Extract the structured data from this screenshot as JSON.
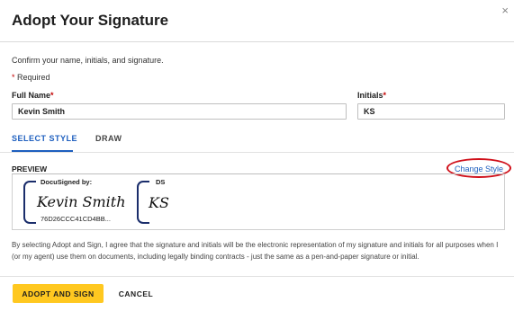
{
  "dialog": {
    "title": "Adopt Your Signature",
    "close_glyph": "×",
    "intro": "Confirm your name, initials, and signature.",
    "required_star": "*",
    "required_text": " Required"
  },
  "form": {
    "full_name_label": "Full Name",
    "full_name_value": "Kevin Smith",
    "initials_label": "Initials",
    "initials_value": "KS",
    "required_star": "*"
  },
  "tabs": [
    {
      "label": "SELECT STYLE",
      "active": true
    },
    {
      "label": "DRAW",
      "active": false
    }
  ],
  "preview": {
    "label": "PREVIEW",
    "change_style": "Change Style",
    "signature_caption": "DocuSigned by:",
    "signature_text": "Kevin Smith",
    "signature_id": "76D26CCC41CD4BB...",
    "initials_caption": "DS",
    "initials_text": "KS"
  },
  "legal_text": "By selecting Adopt and Sign, I agree that the signature and initials will be the electronic representation of my signature and initials for all purposes when I (or my agent) use them on documents, including legally binding contracts - just the same as a pen-and-paper signature or initial.",
  "buttons": {
    "adopt": "ADOPT AND SIGN",
    "cancel": "CANCEL"
  },
  "colors": {
    "accent": "#1e5fbf",
    "primary_button": "#ffc820",
    "highlight_oval": "#d0101a",
    "signature_ink": "#1a2d6b"
  },
  "icons": {
    "close": "close-icon"
  }
}
